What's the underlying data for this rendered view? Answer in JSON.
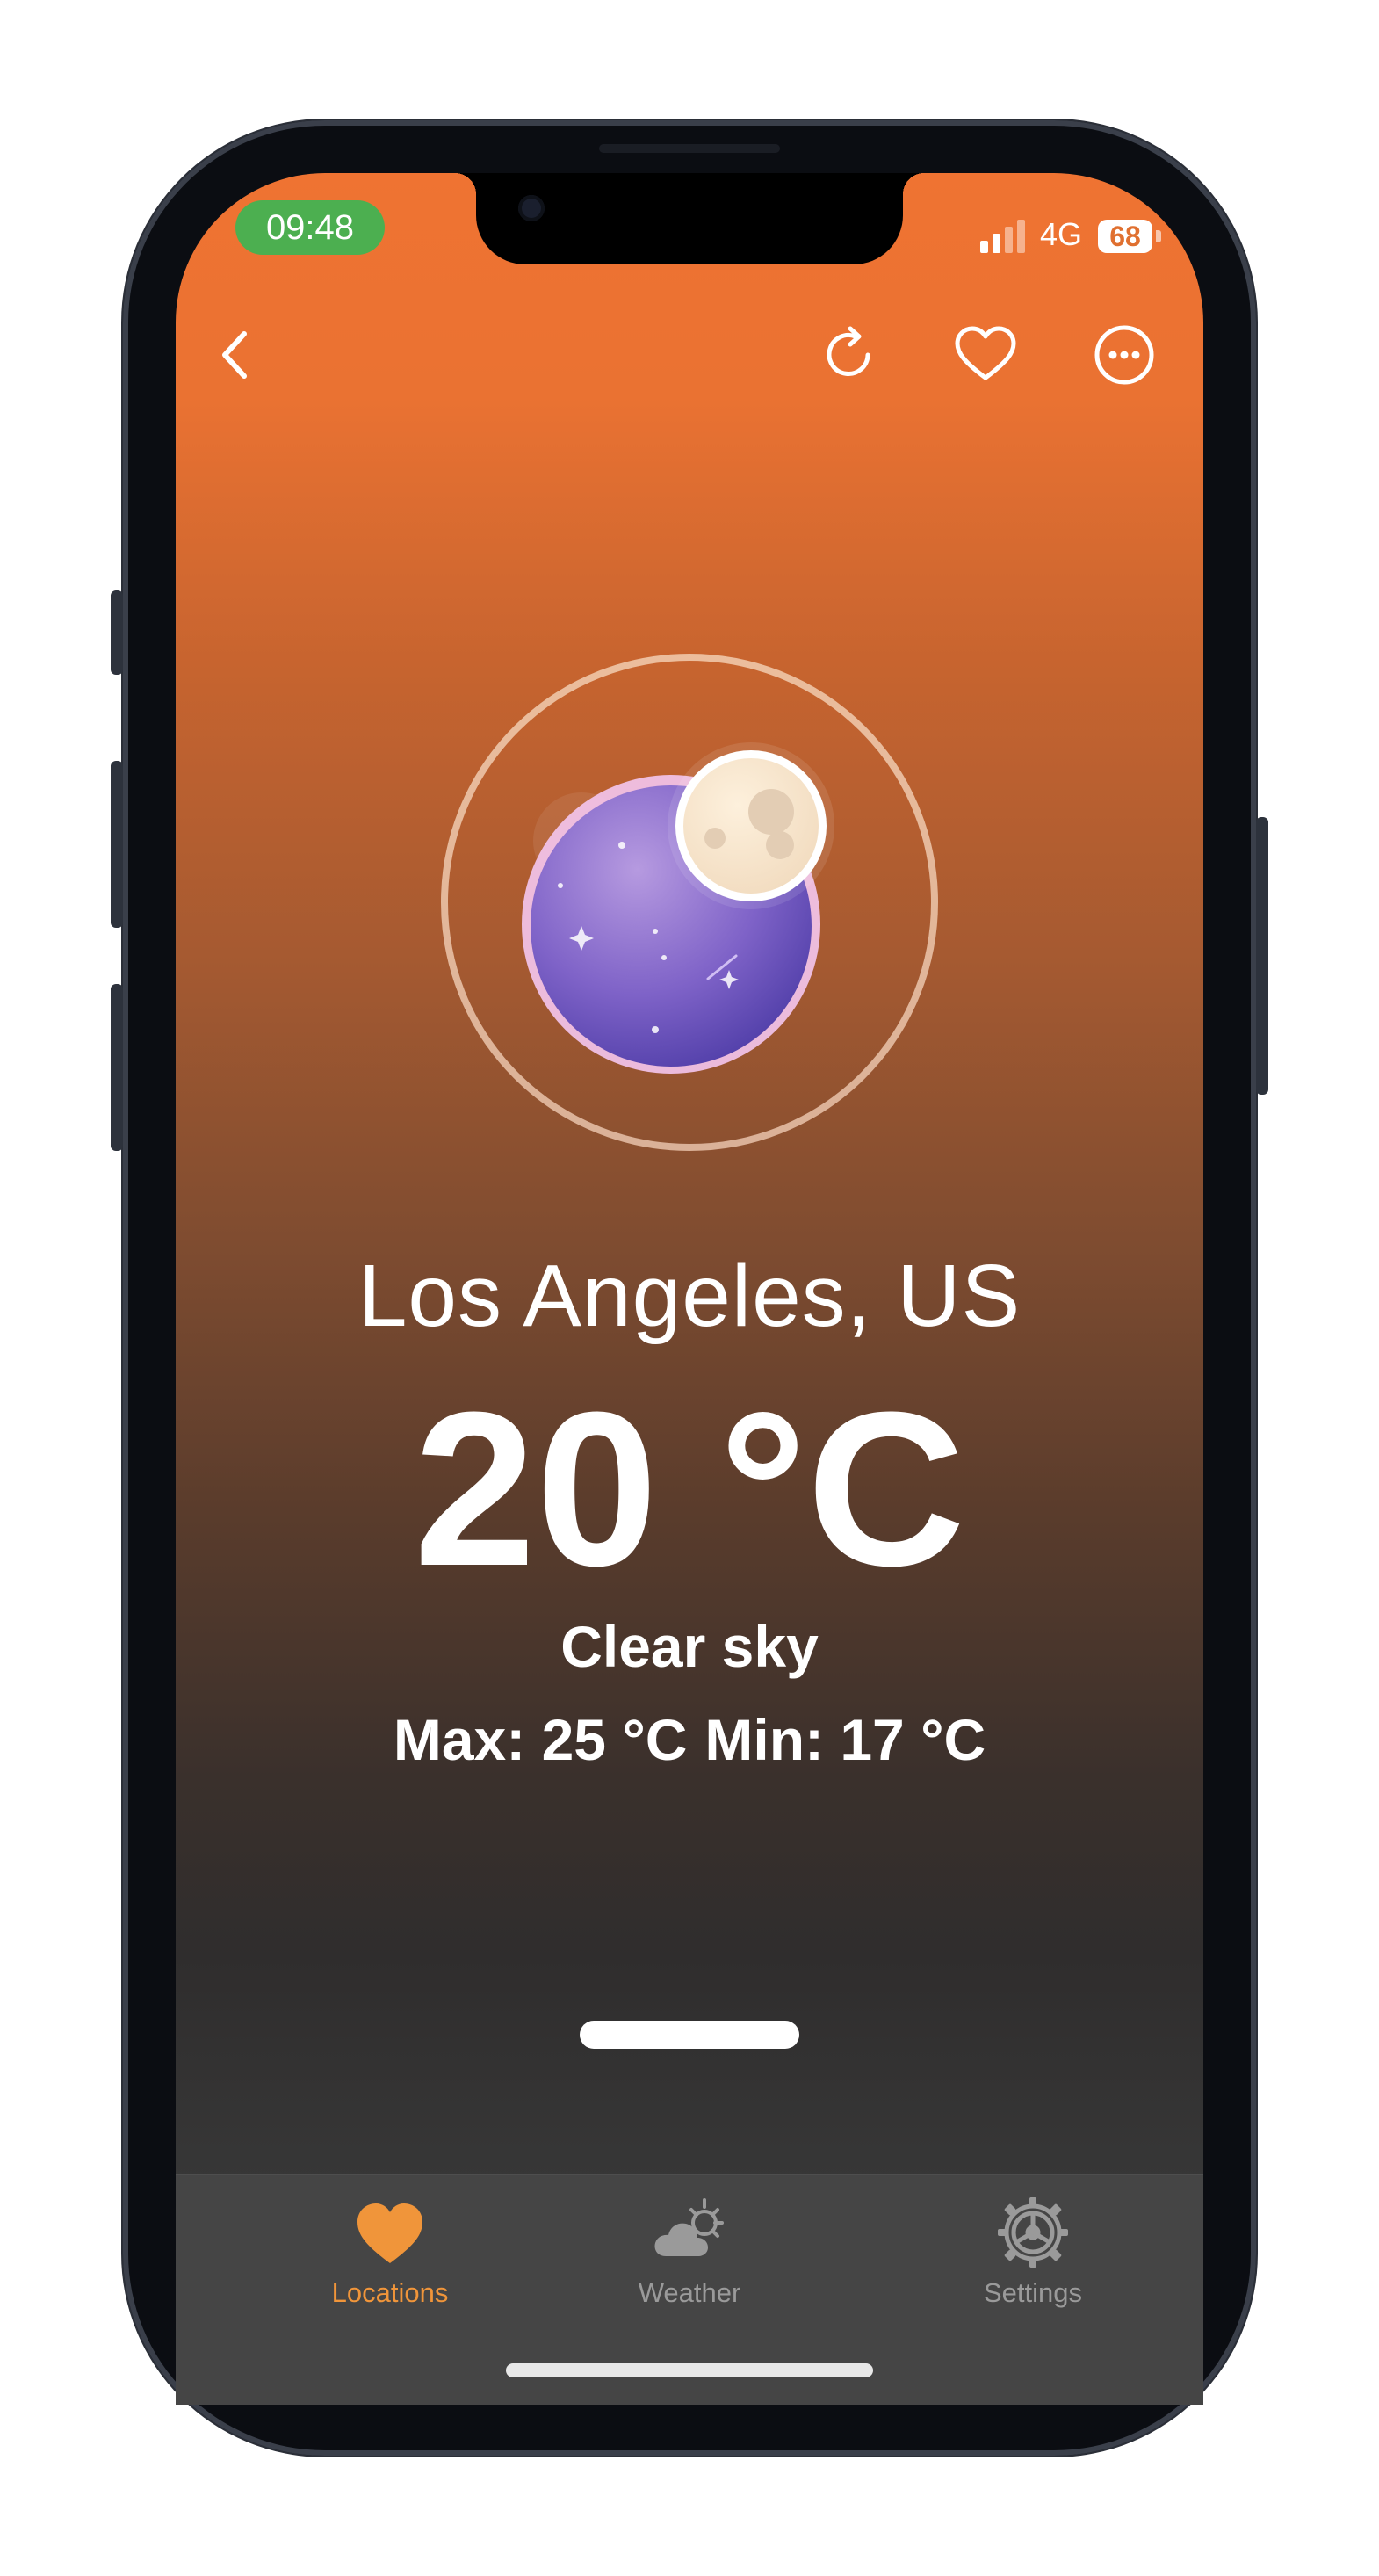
{
  "status_bar": {
    "time": "09:48",
    "network": "4G",
    "battery": "68"
  },
  "toolbar": {
    "back": "back-icon",
    "refresh": "refresh-icon",
    "favorite": "heart-icon",
    "more": "more-icon"
  },
  "weather": {
    "location": "Los Angeles, US",
    "temperature": "20 °C",
    "condition": "Clear sky",
    "max": "Max: 25 °C",
    "min": "Min: 17 °C"
  },
  "tabs": [
    {
      "label": "Locations",
      "icon": "heart-icon",
      "active": true,
      "color": "#f0953a"
    },
    {
      "label": "Weather",
      "icon": "cloud-sun-icon",
      "active": false,
      "color": "#9a9a9a"
    },
    {
      "label": "Settings",
      "icon": "gear-icon",
      "active": false,
      "color": "#9a9a9a"
    }
  ],
  "colors": {
    "accent": "#ef7332",
    "active_tab": "#f0953a",
    "time_pill": "#4caf50"
  }
}
